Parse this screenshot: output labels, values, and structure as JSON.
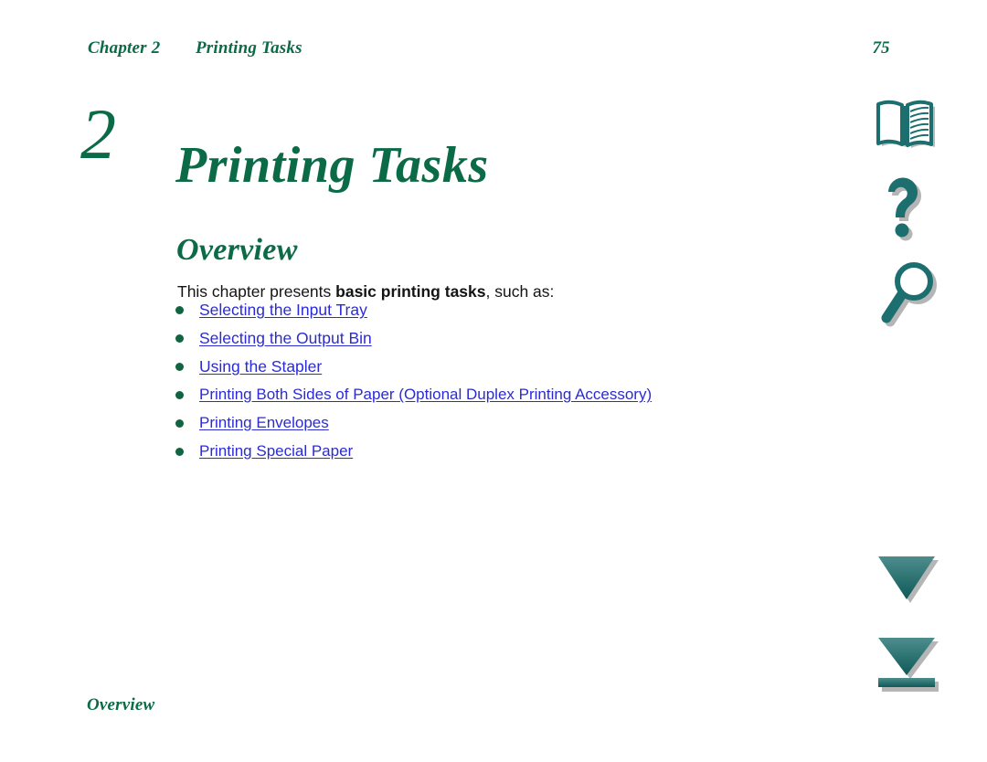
{
  "document": {
    "background_color": "#ffffff",
    "accent_green": "#0b6b47",
    "bullet_green": "#116441",
    "link_blue": "#2b2bd4",
    "icon_teal": "#1d6e6e"
  },
  "running_header": {
    "chapter_label": "Chapter 2",
    "section_title": "Printing Tasks",
    "page_number": "75"
  },
  "chapter": {
    "number": "2",
    "title": "Printing Tasks"
  },
  "section": {
    "heading": "Overview",
    "intro_prefix": "This chapter presents ",
    "intro_bold": "basic printing tasks",
    "intro_suffix": ", such as:"
  },
  "topic_links": [
    {
      "label": "Selecting the Input Tray"
    },
    {
      "label": "Selecting the Output Bin"
    },
    {
      "label": "Using the Stapler"
    },
    {
      "label": "Printing Both Sides of Paper (Optional Duplex Printing Accessory)"
    },
    {
      "label": "Printing Envelopes"
    },
    {
      "label": "Printing Special Paper"
    }
  ],
  "footer": {
    "section_label": "Overview"
  },
  "nav_icons": [
    {
      "name": "open-book-icon",
      "tooltip": "Table of Contents"
    },
    {
      "name": "question-mark-icon",
      "tooltip": "Help"
    },
    {
      "name": "magnifying-glass-icon",
      "tooltip": "Search"
    },
    {
      "name": "down-triangle-icon",
      "tooltip": "Next Page"
    },
    {
      "name": "down-triangle-bar-icon",
      "tooltip": "Last Page"
    }
  ]
}
